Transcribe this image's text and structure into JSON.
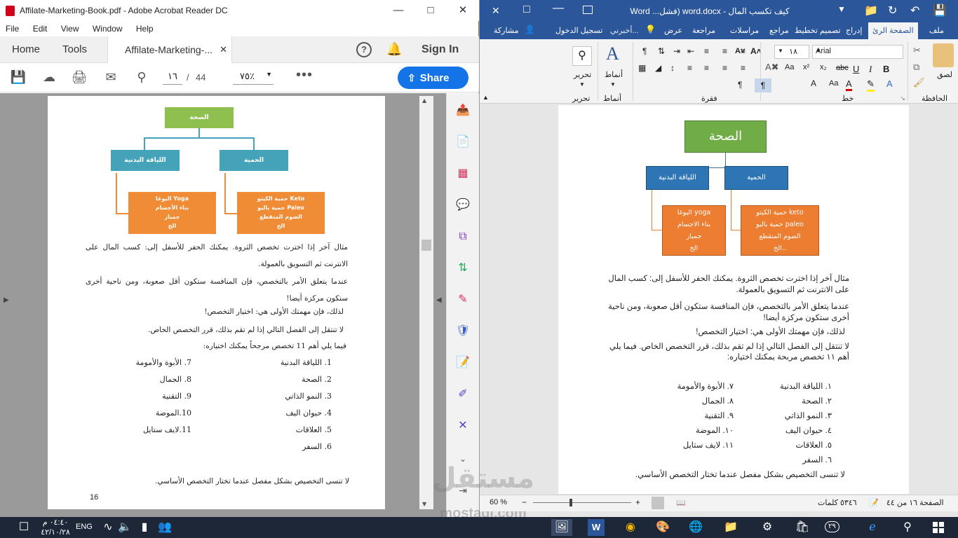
{
  "acrobat": {
    "title": "Affilate-Marketing-Book.pdf - Adobe Acrobat Reader DC",
    "menu": [
      "File",
      "Edit",
      "View",
      "Window",
      "Help"
    ],
    "tabs": {
      "home": "Home",
      "tools": "Tools",
      "doc": "Affilate-Marketing-..."
    },
    "sign_in": "Sign In",
    "page_current": "١٦",
    "page_sep": "/",
    "page_total": "44",
    "zoom": "٧٥٪",
    "share": "Share",
    "page_number": "16",
    "chart": {
      "root": "الصحة",
      "left": "اللياقة البدنية",
      "right": "الحمية",
      "left_child": [
        "اليوغا Yoga",
        "بناء الأجسام",
        "جمباز",
        "الخ"
      ],
      "right_child": [
        "حمية الكيتو Keto",
        "حمية باليو Paleo",
        "الصوم المتقطع",
        "الخ"
      ]
    },
    "para1": "مثال آخر إذا اخترت تخصص الثروة. يمكنك الحفر للأسفل إلى: كسب المال على الانترنت ثم التسويق بالعمولة.",
    "para2": "عندما يتعلق الأمر بالتخصص، فإن المنافسة ستكون أقل صعوبة، ومن ناحية أخرى ستكون مركزة أيضا!",
    "para3": "لذلك، فإن مهمتك الأولى هي: اختيار التخصص!",
    "para4": "لا تنتقل إلى الفصل التالي إذا لم تقم بذلك، قرر التخصص الخاص.",
    "para5": "فيما يلي أهم 11 تخصص مرجحاً يمكنك اختياره:",
    "list_right": [
      "1.   اللياقة البدنية",
      "2.   الصحة",
      "3.   النمو الذاتي",
      "4.   حيوان اليف",
      "5.   العلاقات",
      "6.   السفر"
    ],
    "list_left": [
      "7.   الأبوة والأمومة",
      "8.   الجمال",
      "9.   التقنية",
      "10.الموضة",
      "11.لايف ستايل"
    ],
    "footer": "لا تنسى التخصيص بشكل مفصل عندما تختار التخصص الأساسي."
  },
  "word": {
    "title": "كيف تكسب المال - word.docx (فشل...   Word",
    "tabs": [
      "ملف",
      "الصفحة الرئ",
      "إدراج",
      "تصميم",
      "تخطيط",
      "مراجع",
      "مراسلات",
      "مراجعة",
      "عرض",
      "أخبرني...",
      "تسجيل الدخول",
      "مشاركة"
    ],
    "font": "Arial",
    "size": "١٨",
    "groups": {
      "clipboard": "الحافظة",
      "font": "خط",
      "paragraph": "فقرة",
      "styles": "أنماط",
      "editing": "تحرير"
    },
    "paste": "لصق",
    "styles_btn": "أنماط",
    "edit_btn": "تحرير",
    "chart": {
      "root": "الصحة",
      "left": "اللياقة البدنية",
      "right": "الحمية",
      "left_child": [
        "اليوغا yoga",
        "بناء الاجسام",
        "جمباز",
        "الخ"
      ],
      "right_child": [
        "حمية الكيتو keto",
        "حمية باليو paleo",
        "الصوم المتقطع",
        "الخ.."
      ]
    },
    "para1": "مثال آخر إذا اخترت تخصص الثروة. يمكنك الحفر للأسفل إلى: كسب المال على الانترنت ثم التسويق بالعمولة.",
    "para2": "عندما يتعلق الأمر بالتخصص، فإن المنافسة ستكون أقل صعوبة، ومن ناحية أخرى ستكون مركزة أيضا!",
    "para3": "لذلك، فإن مهمتك الأولى هي: اختيار التخصص!",
    "para4": "لا تنتقل إلى الفصل التالي إذا لم تقم بذلك، قرر التخصص الخاص. فيما يلي أهم ١١ تخصص مربحة يمكنك اختياره:",
    "list_right": [
      "١. اللياقة البدنية",
      "٢. الصحة",
      "٣. النمو الذاتي",
      "٤. حيوان اليف",
      "٥. العلاقات",
      "٦. السفر"
    ],
    "list_left": [
      "٧. الأبوة والأمومة",
      "٨. الجمال",
      "٩. التقنية",
      "١٠. الموضة",
      "١١. لايف ستايل"
    ],
    "footer": "لا تنسى التخصيص بشكل مفصل عندما تختار التخصص الأساسي.",
    "status": {
      "page": "الصفحة ١٦ من ٤٤",
      "words": "٥٣٤٦ كلمات",
      "zoom": "60 %"
    }
  },
  "taskbar": {
    "time": "٠٤:٤٠ م",
    "date": "٤٢/١٠/٢٨",
    "lang": "ENG",
    "badge": "٢٩"
  },
  "watermark": {
    "name": "مستقل",
    "url": "mostaql.com"
  }
}
